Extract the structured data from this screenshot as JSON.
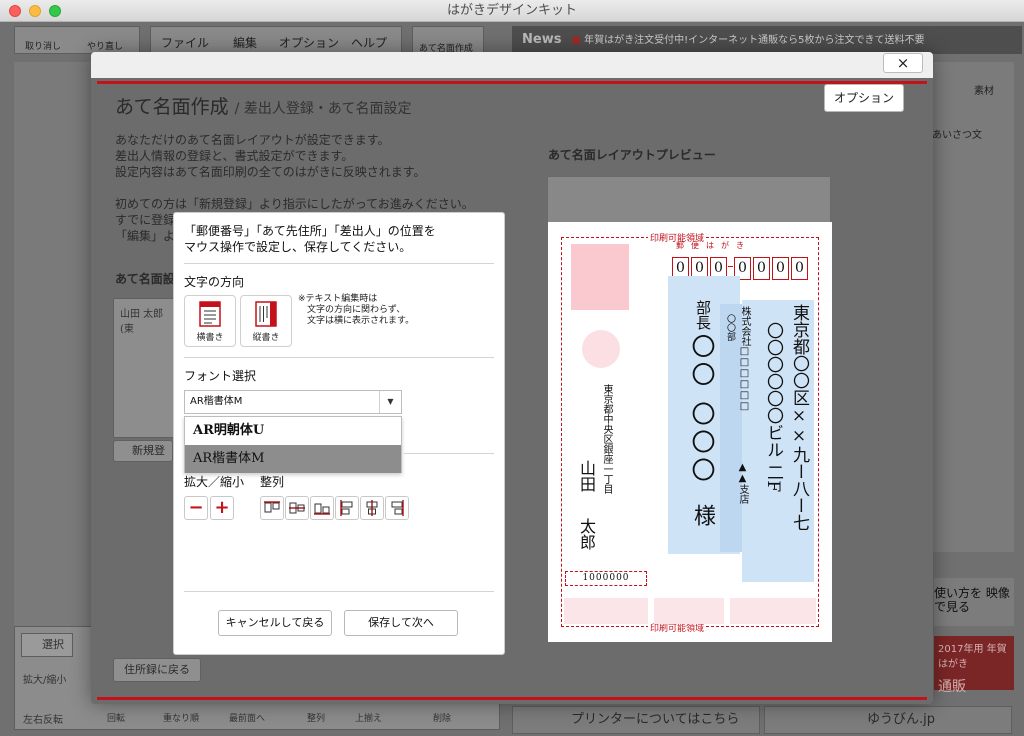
{
  "window": {
    "title": "はがきデザインキット"
  },
  "toolbar": {
    "undo": "取り消し",
    "redo": "やり直し",
    "menu": [
      "ファイル",
      "編集",
      "オプション",
      "ヘルプ"
    ],
    "address_tab": "あて名面作成",
    "news_label": "News",
    "news_text": "年賀はがき注文受付中!インターネット通販なら5枚から注文できて送料不要"
  },
  "right_panel": {
    "label": "素材",
    "greeting": "あいさつ文"
  },
  "bottom": {
    "select_tool": "選択",
    "zoom": "拡大/縮小",
    "flip": "左右反転",
    "rotate": "回転",
    "order": "重なり順",
    "front": "最前面へ",
    "align": "整列",
    "align_value": "上揃え",
    "delete": "削除",
    "printer": "プリンターについてはこちら",
    "yubin": "ゆうびん.jp",
    "video": "使い方を 映像で見る",
    "promo1": "2017年用 年賀はがき",
    "promo2": "通販"
  },
  "modal": {
    "close": "×",
    "title": "あて名面作成",
    "subtitle": "/ 差出人登録・あて名面設定",
    "option_button": "オプション",
    "desc": "あなただけのあて名面レイアウトが設定できます。\n差出人情報の登録と、書式設定ができます。\n設定内容はあて名面印刷の全てのはがきに反映されます。",
    "desc2": "初めての方は「新規登録」より指示にしたがってお進みください。\nすでに登録\n「編集」より",
    "list_label": "あて名面設",
    "list_item": "山田 太郎(東",
    "new_button": "新規登",
    "back_button": "住所録に戻る",
    "preview_label": "あて名面レイアウトプレビュー"
  },
  "dialog": {
    "message": "「郵便番号」「あて先住所」「差出人」の位置を\nマウス操作で設定し、保存してください。",
    "direction_label": "文字の方向",
    "horizontal": "横書き",
    "vertical": "縦書き",
    "note": "※テキスト編集時は\n　文字の方向に関わらず、\n　文字は横に表示されます。",
    "font_label": "フォント選択",
    "font_value": "AR楷書体M",
    "font_options": [
      "AR明朝体U",
      "AR楷書体M"
    ],
    "zoom_label": "拡大／縮小",
    "align_label": "整列",
    "zoom_out": "−",
    "zoom_in": "+",
    "cancel": "キャンセルして戻る",
    "save": "保存して次へ"
  },
  "postcard": {
    "printable": "印刷可能領域",
    "yubin": "郵便はがき",
    "zip": [
      "0",
      "0",
      "0",
      "0",
      "0",
      "0",
      "0"
    ],
    "address": "東京都〇〇区××九ー八ー七",
    "address2": "〇〇〇〇〇〇ビル 二F",
    "company": "株式会社□□□□□□",
    "dept": "〇〇部",
    "branch": "▲▲支店",
    "title": "部長",
    "name": "〇〇 〇〇〇",
    "honorific": "様",
    "sender_address": "東京都中央区銀座一丁目",
    "sender_name1": "山田",
    "sender_name2": "太郎",
    "sender_zip": "1000000"
  }
}
